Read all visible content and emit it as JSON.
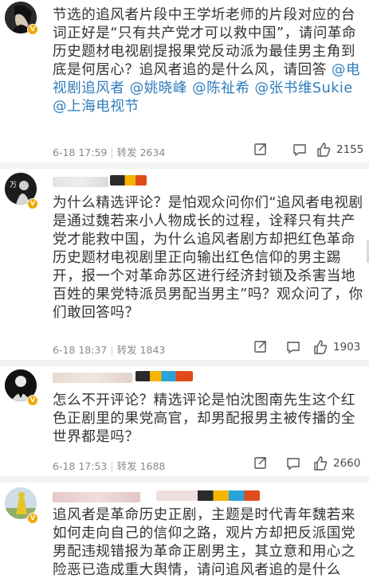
{
  "posts": [
    {
      "text_parts": [
        {
          "t": "节选的追风者片段中王学圻老师的片段对应的台词正好是“只有共产党才可以救中国”，请问革命历史题材电视剧提报果党反动派为最佳男主角到底是何居心？追风者追的是什么风，请回答 ",
          "mention": false
        },
        {
          "t": "@电视剧追风者",
          "mention": true
        },
        {
          "t": " ",
          "mention": false
        },
        {
          "t": "@姚晓峰",
          "mention": true
        },
        {
          "t": " ",
          "mention": false
        },
        {
          "t": "@陈祉希",
          "mention": true
        },
        {
          "t": " ",
          "mention": false
        },
        {
          "t": "@张书维Sukie",
          "mention": true
        },
        {
          "t": " ",
          "mention": false
        },
        {
          "t": "@上海电视节",
          "mention": true
        }
      ],
      "time": "6-18 17:59",
      "repost": "转发 2634",
      "likes": "2155"
    },
    {
      "text_parts": [
        {
          "t": "为什么精选评论？是怕观众问你们“追风者电视剧是通过魏若来小人物成长的过程，诠释只有共产党才能救中国，为什么追风者剧方却把红色革命历史题材电视剧里正向输出红色信仰的男主踢开，报一个对革命苏区进行经济封锁及杀害当地百姓的果党特派员男配当男主”吗？观众问了，你们敢回答吗？",
          "mention": false
        }
      ],
      "time": "6-18 18:37",
      "repost": "转发 1843",
      "likes": "1903"
    },
    {
      "text_parts": [
        {
          "t": "怎么不开评论？精选评论是怕沈图南先生这个红色正剧里的果党高官，却男配报男主被传播的全世界都是吗？",
          "mention": false
        }
      ],
      "time": "6-18 17:53",
      "repost": "转发 1688",
      "likes": "2660"
    },
    {
      "text_parts": [
        {
          "t": "追风者是革命历史正剧，主题是时代青年魏若来如何走向自己的信仰之路，观片方却把反派国党男配违规错报为革命正剧男主，其立意和用心之险恶已造成重大舆情，请问追风者追的是什么",
          "mention": false
        }
      ],
      "time": "",
      "repost": "",
      "likes": ""
    }
  ],
  "colors": {
    "mention": "#2f7dbd",
    "vip_badge": "#f0a800",
    "divider": "#f2f2f2"
  },
  "icons": {
    "share": "share-icon",
    "comment": "comment-icon",
    "like": "thumbs-up-icon"
  }
}
